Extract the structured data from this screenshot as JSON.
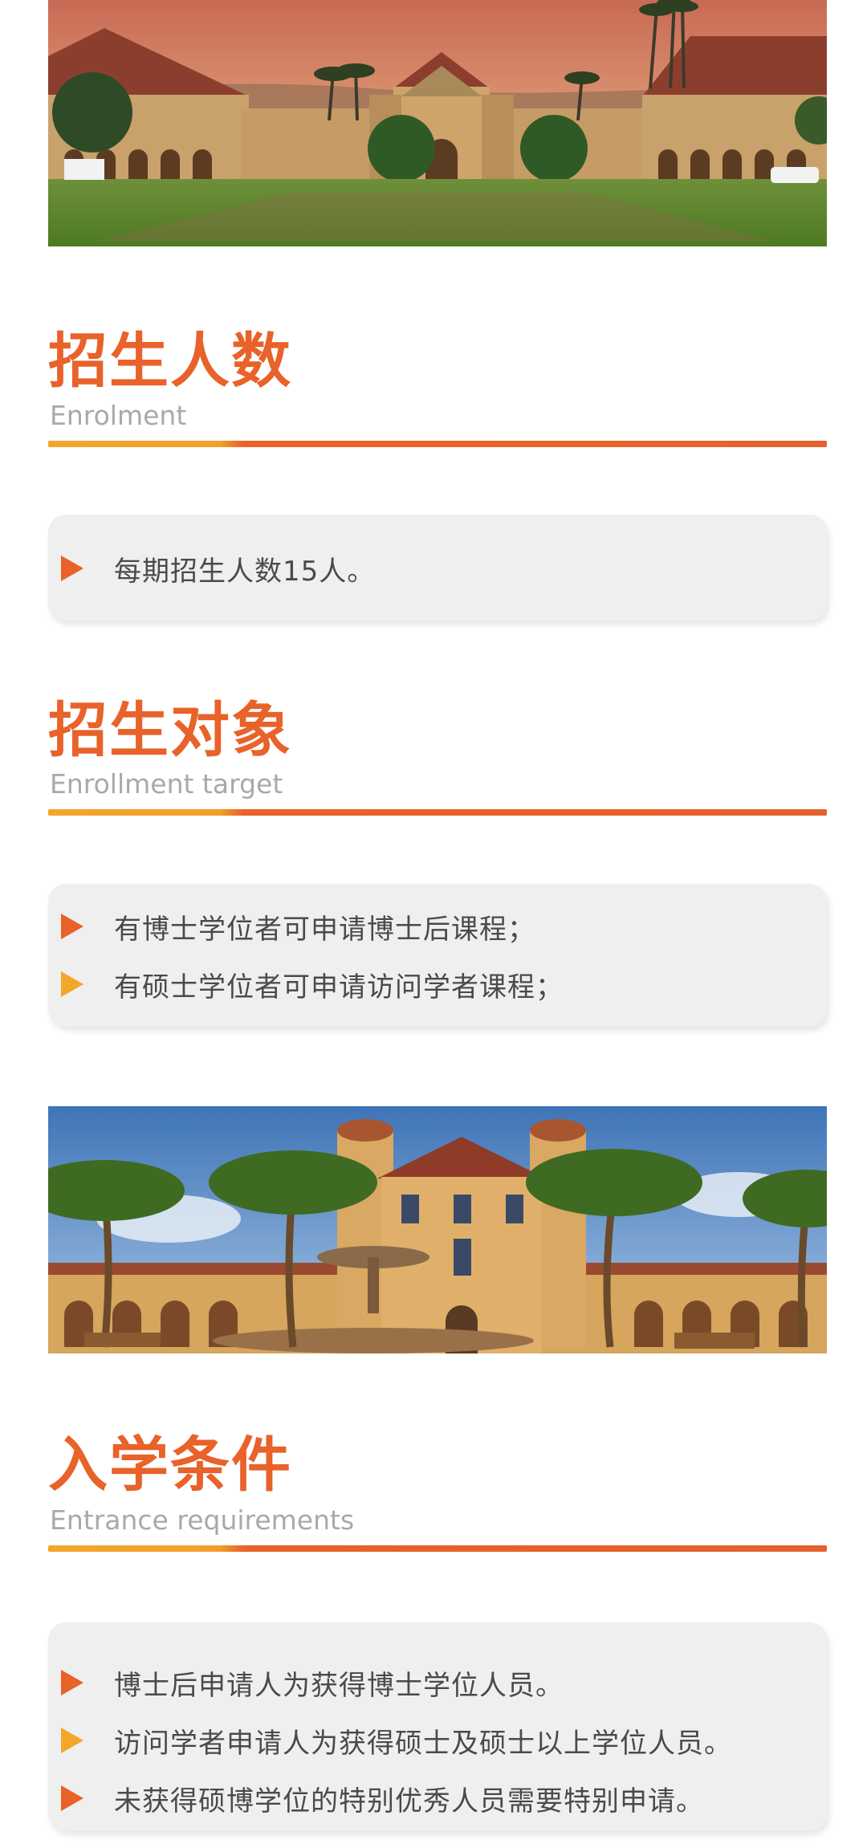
{
  "sections": [
    {
      "title": "招生人数",
      "subtitle": "Enrolment",
      "items": [
        "每期招生人数15人。"
      ]
    },
    {
      "title": "招生对象",
      "subtitle": "Enrollment target",
      "items": [
        "有博士学位者可申请博士后课程；",
        "有硕士学位者可申请访问学者课程；"
      ]
    },
    {
      "title": "入学条件",
      "subtitle": "Entrance requirements",
      "items": [
        "博士后申请人为获得博士学位人员。",
        "访问学者申请人为获得硕士及硕士以上学位人员。",
        "未获得硕博学位的特别优秀人员需要特别申请。"
      ]
    }
  ],
  "colors": {
    "title": "#e8622a",
    "accent_orange": "#e8622a",
    "accent_yellow": "#f4a62b",
    "subtitle": "#a9a9a9",
    "card_bg": "#efefef",
    "body_text": "#4a4a4a"
  },
  "icons": {
    "bullet": "triangle-right-icon"
  }
}
